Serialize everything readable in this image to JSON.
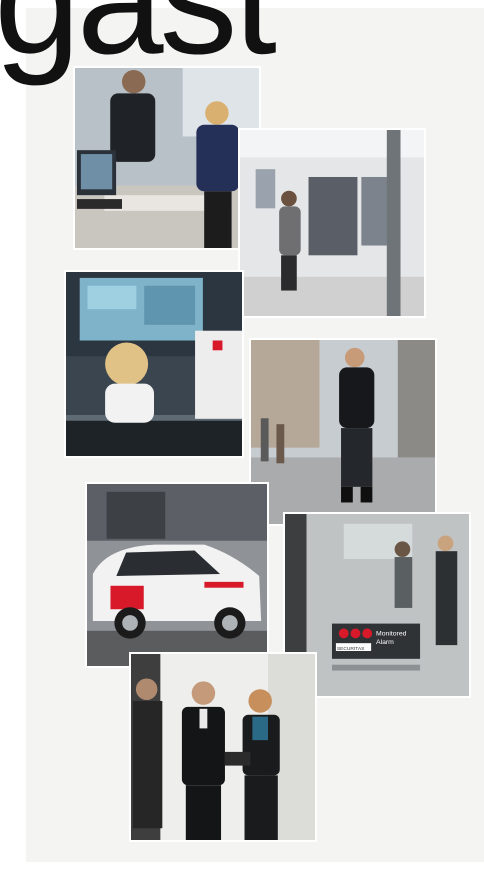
{
  "headline": {
    "text": "gast"
  },
  "colors": {
    "page_background": "#ffffff",
    "panel_background": "#f4f4f3",
    "headline": "#111111",
    "brand_red": "#d7192a"
  },
  "photos": [
    {
      "id": "reception-desk",
      "icon": "reception-scene"
    },
    {
      "id": "retail-store",
      "icon": "store-scene"
    },
    {
      "id": "control-room-operator",
      "icon": "headset-operator-scene"
    },
    {
      "id": "street-patrol-guard",
      "icon": "patrol-guard-scene"
    },
    {
      "id": "patrol-car",
      "icon": "car-scene"
    },
    {
      "id": "monitored-premises-sign",
      "icon": "door-sign-scene"
    },
    {
      "id": "business-meeting",
      "icon": "meeting-scene"
    }
  ],
  "sign": {
    "brand_text": "SECURITAS",
    "line_1": "Monitored",
    "line_2": "Alarm"
  }
}
